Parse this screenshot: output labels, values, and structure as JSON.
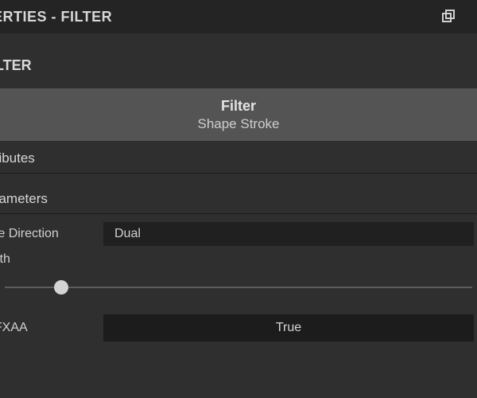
{
  "titlebar": {
    "title": "PROPERTIES - FILTER",
    "popout_icon": "popout-icon"
  },
  "breadcrumb": {
    "label": "FILTER"
  },
  "filter_band": {
    "heading": "Filter",
    "subheading": "Shape Stroke"
  },
  "sections": {
    "attributes_label": "Attributes",
    "parameters_label": "Parameters"
  },
  "params": {
    "stroke_direction": {
      "label": "Stroke Direction",
      "value": "Dual"
    },
    "width": {
      "label": "Width",
      "slider_percent": 12
    },
    "use_fxaa": {
      "label": "Use FXAA",
      "value": "True"
    }
  }
}
